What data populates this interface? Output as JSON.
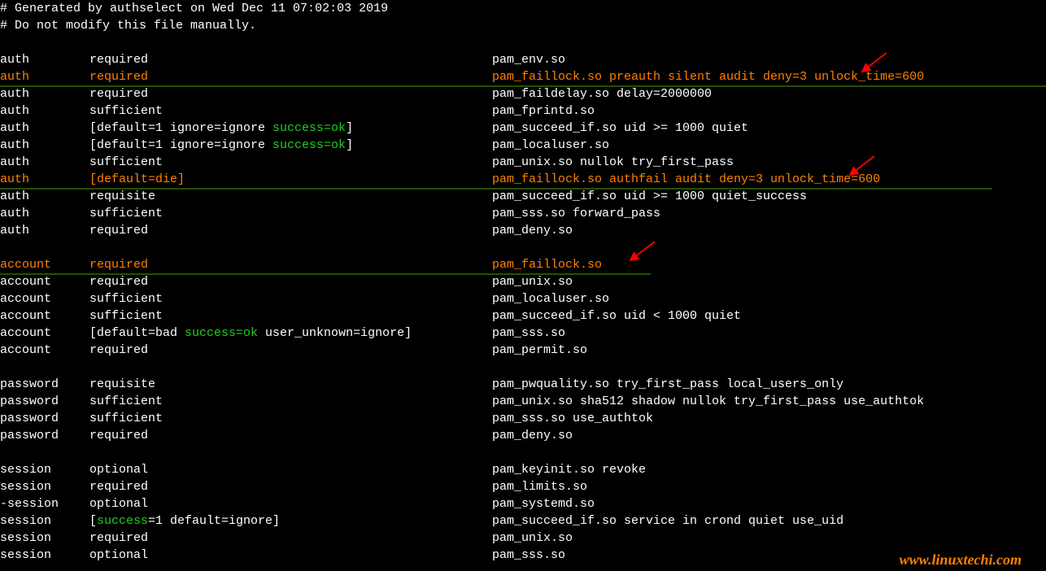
{
  "comment1": "# Generated by authselect on Wed Dec 11 07:02:03 2019",
  "comment2": "# Do not modify this file manually.",
  "blank": " ",
  "rows": {
    "r1": {
      "c1": "auth",
      "c2": "required",
      "c3": "pam_env.so"
    },
    "r2": {
      "c1": "auth",
      "c2": "required",
      "c3": "pam_faillock.so preauth silent audit deny=3 unlock_time=600"
    },
    "r3": {
      "c1": "auth",
      "c2": "required",
      "c3": "pam_faildelay.so delay=2000000"
    },
    "r4": {
      "c1": "auth",
      "c2": "sufficient",
      "c3": "pam_fprintd.so"
    },
    "r5": {
      "c1": "auth",
      "c2a": "[default=1 ignore=ignore ",
      "c2b": "success=ok",
      "c2c": "]",
      "c3": "pam_succeed_if.so uid >= 1000 quiet"
    },
    "r6": {
      "c1": "auth",
      "c2a": "[default=1 ignore=ignore ",
      "c2b": "success=ok",
      "c2c": "]",
      "c3": "pam_localuser.so"
    },
    "r7": {
      "c1": "auth",
      "c2": "sufficient",
      "c3": "pam_unix.so nullok try_first_pass"
    },
    "r8": {
      "c1": "auth",
      "c2": "[default=die]",
      "c3": "pam_faillock.so authfail audit deny=3 unlock_time=600"
    },
    "r9": {
      "c1": "auth",
      "c2": "requisite",
      "c3": "pam_succeed_if.so uid >= 1000 quiet_success"
    },
    "r10": {
      "c1": "auth",
      "c2": "sufficient",
      "c3": "pam_sss.so forward_pass"
    },
    "r11": {
      "c1": "auth",
      "c2": "required",
      "c3": "pam_deny.so"
    },
    "r12": {
      "c1": "account",
      "c2": "required",
      "c3": "pam_faillock.so"
    },
    "r13": {
      "c1": "account",
      "c2": "required",
      "c3": "pam_unix.so"
    },
    "r14": {
      "c1": "account",
      "c2": "sufficient",
      "c3": "pam_localuser.so"
    },
    "r15": {
      "c1": "account",
      "c2": "sufficient",
      "c3": "pam_succeed_if.so uid < 1000 quiet"
    },
    "r16": {
      "c1": "account",
      "c2a": "[default=bad ",
      "c2b": "success=ok",
      "c2c": " user_unknown=ignore]",
      "c3": "pam_sss.so"
    },
    "r17": {
      "c1": "account",
      "c2": "required",
      "c3": "pam_permit.so"
    },
    "r18": {
      "c1": "password",
      "c2": "requisite",
      "c3": "pam_pwquality.so try_first_pass local_users_only"
    },
    "r19": {
      "c1": "password",
      "c2": "sufficient",
      "c3": "pam_unix.so sha512 shadow nullok try_first_pass use_authtok"
    },
    "r20": {
      "c1": "password",
      "c2": "sufficient",
      "c3": "pam_sss.so use_authtok"
    },
    "r21": {
      "c1": "password",
      "c2": "required",
      "c3": "pam_deny.so"
    },
    "r22": {
      "c1": "session",
      "c2": "optional",
      "c3": "pam_keyinit.so revoke"
    },
    "r23": {
      "c1": "session",
      "c2": "required",
      "c3": "pam_limits.so"
    },
    "r24": {
      "c1": "-session",
      "c2": "optional",
      "c3": "pam_systemd.so"
    },
    "r25": {
      "c1": "session",
      "c2a": "[",
      "c2b": "success",
      "c2c": "=1 default=ignore]",
      "c3": "pam_succeed_if.so service in crond quiet use_uid"
    },
    "r26": {
      "c1": "session",
      "c2": "required",
      "c3": "pam_unix.so"
    },
    "r27": {
      "c1": "session",
      "c2": "optional",
      "c3": "pam_sss.so"
    }
  },
  "watermark": "www.linuxtechi.com"
}
